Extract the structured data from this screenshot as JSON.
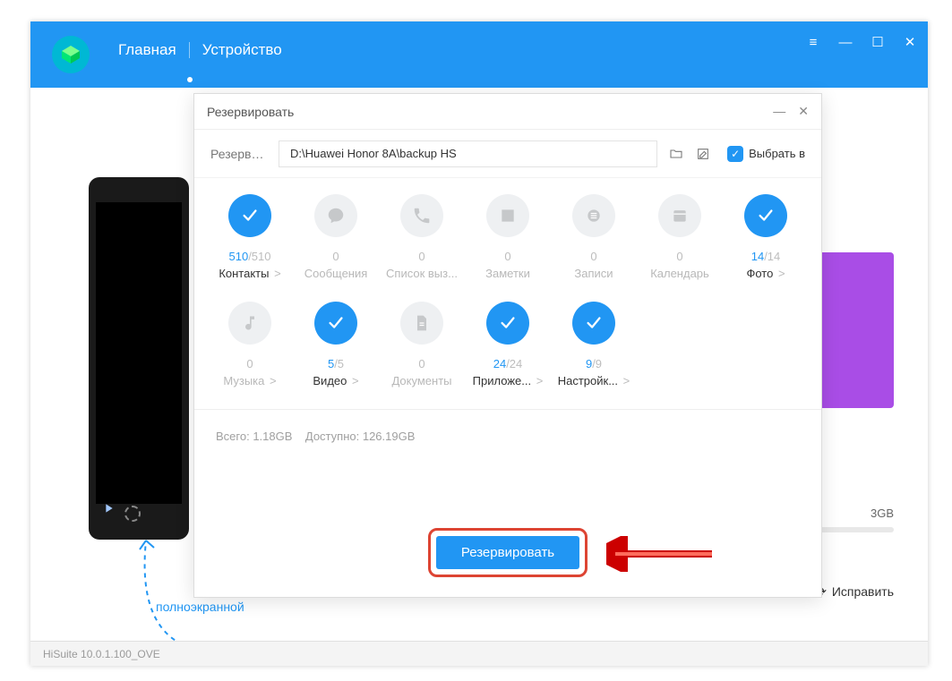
{
  "window": {
    "menu_icon": "≡",
    "min_icon": "—",
    "max_icon": "☐",
    "close_icon": "✕"
  },
  "nav": {
    "home": "Главная",
    "device": "Устройство"
  },
  "statusbar": {
    "version": "HiSuite 10.0.1.100_OVE"
  },
  "note": {
    "line1": "полноэкранной"
  },
  "side": {
    "storage": "3GB",
    "fix": "Исправить"
  },
  "dialog": {
    "title": "Резервировать",
    "minimize": "—",
    "close": "✕",
    "path_label": "Резервн...",
    "path_value": "D:\\Huawei Honor 8A\\backup HS",
    "select_all": "Выбрать в",
    "totals": {
      "total_label": "Всего:",
      "total_value": "1.18GB",
      "avail_label": "Доступно:",
      "avail_value": "126.19GB"
    },
    "action": "Резервировать",
    "categories": [
      {
        "key": "contacts",
        "selected": true,
        "sel": "510",
        "total": "510",
        "label": "Контакты",
        "chev": true
      },
      {
        "key": "messages",
        "selected": false,
        "sel": "",
        "total": "0",
        "label": "Сообщения",
        "chev": false
      },
      {
        "key": "calllog",
        "selected": false,
        "sel": "",
        "total": "0",
        "label": "Список выз...",
        "chev": false
      },
      {
        "key": "notes",
        "selected": false,
        "sel": "",
        "total": "0",
        "label": "Заметки",
        "chev": false
      },
      {
        "key": "records",
        "selected": false,
        "sel": "",
        "total": "0",
        "label": "Записи",
        "chev": false
      },
      {
        "key": "calendar",
        "selected": false,
        "sel": "",
        "total": "0",
        "label": "Календарь",
        "chev": false
      },
      {
        "key": "photos",
        "selected": true,
        "sel": "14",
        "total": "14",
        "label": "Фото",
        "chev": true
      },
      {
        "key": "music",
        "selected": false,
        "sel": "",
        "total": "0",
        "label": "Музыка",
        "chev": true
      },
      {
        "key": "video",
        "selected": true,
        "sel": "5",
        "total": "5",
        "label": "Видео",
        "chev": true
      },
      {
        "key": "docs",
        "selected": false,
        "sel": "",
        "total": "0",
        "label": "Документы",
        "chev": false
      },
      {
        "key": "apps",
        "selected": true,
        "sel": "24",
        "total": "24",
        "label": "Приложе...",
        "chev": true
      },
      {
        "key": "settings",
        "selected": true,
        "sel": "9",
        "total": "9",
        "label": "Настройк...",
        "chev": true
      }
    ],
    "icons": {
      "contacts": "check",
      "messages": "bubble",
      "calllog": "phone",
      "notes": "note",
      "records": "mic",
      "calendar": "calendar",
      "photos": "check",
      "music": "music",
      "video": "check",
      "docs": "doc",
      "apps": "check",
      "settings": "check"
    }
  }
}
